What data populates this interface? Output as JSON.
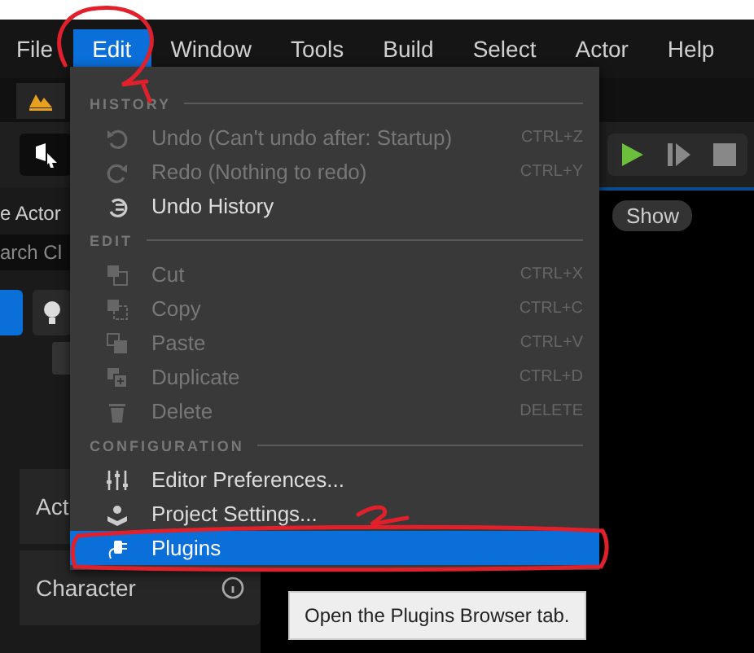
{
  "menubar": [
    {
      "label": "File",
      "selected": false
    },
    {
      "label": "Edit",
      "selected": true
    },
    {
      "label": "Window",
      "selected": false
    },
    {
      "label": "Tools",
      "selected": false
    },
    {
      "label": "Build",
      "selected": false
    },
    {
      "label": "Select",
      "selected": false
    },
    {
      "label": "Actor",
      "selected": false
    },
    {
      "label": "Help",
      "selected": false
    }
  ],
  "left_panel": {
    "title": "e Actor",
    "search": {
      "placeholder": "arch Cl"
    },
    "items": [
      {
        "label": "Act"
      },
      {
        "label": "Character"
      }
    ]
  },
  "viewport": {
    "show_button": "Show"
  },
  "edit_menu": {
    "sections": [
      {
        "title": "HISTORY",
        "items": [
          {
            "label": "Undo (Can't undo after: Startup)",
            "shortcut": "CTRL+Z",
            "disabled": true,
            "selected": false
          },
          {
            "label": "Redo (Nothing to redo)",
            "shortcut": "CTRL+Y",
            "disabled": true,
            "selected": false
          },
          {
            "label": "Undo History",
            "disabled": false,
            "selected": false
          }
        ]
      },
      {
        "title": "EDIT",
        "items": [
          {
            "label": "Cut",
            "shortcut": "CTRL+X",
            "disabled": true,
            "selected": false
          },
          {
            "label": "Copy",
            "shortcut": "CTRL+C",
            "disabled": true,
            "selected": false
          },
          {
            "label": "Paste",
            "shortcut": "CTRL+V",
            "disabled": true,
            "selected": false
          },
          {
            "label": "Duplicate",
            "shortcut": "CTRL+D",
            "disabled": true,
            "selected": false
          },
          {
            "label": "Delete",
            "shortcut": "DELETE",
            "disabled": true,
            "selected": false
          }
        ]
      },
      {
        "title": "CONFIGURATION",
        "items": [
          {
            "label": "Editor Preferences...",
            "disabled": false,
            "selected": false
          },
          {
            "label": "Project Settings...",
            "disabled": false,
            "selected": false
          },
          {
            "label": "Plugins",
            "disabled": false,
            "selected": true
          }
        ]
      }
    ]
  },
  "tooltip": "Open the Plugins Browser tab."
}
